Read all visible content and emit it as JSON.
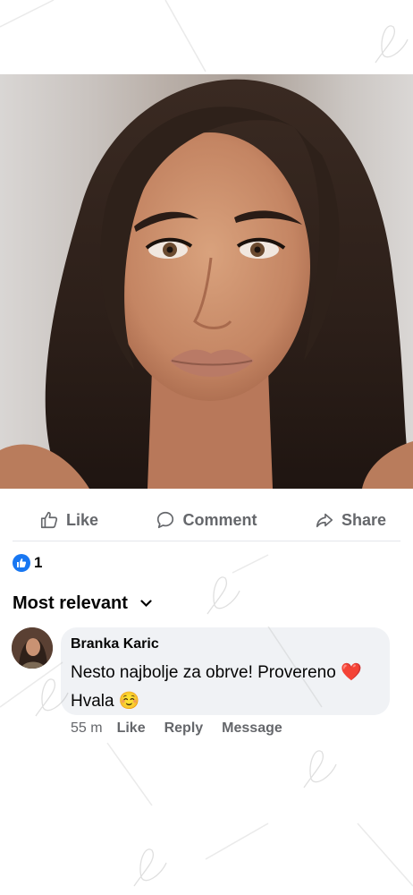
{
  "post": {
    "image_alt": "Portrait photo of a woman with long wavy dark brown hair and defined brows"
  },
  "actions": {
    "like_label": "Like",
    "comment_label": "Comment",
    "share_label": "Share"
  },
  "reactions": {
    "count": "1",
    "type": "like"
  },
  "comments_sort": {
    "label": "Most relevant"
  },
  "comment": {
    "author": "Branka Karic",
    "text_line1": "Nesto najbolje za obrve! Provereno ❤️",
    "text_line2": "Hvala ☺️",
    "time": "55 m",
    "like_label": "Like",
    "reply_label": "Reply",
    "message_label": "Message"
  },
  "colors": {
    "accent": "#1877f2",
    "muted_text": "#65676b",
    "bubble_bg": "#f0f2f5"
  }
}
